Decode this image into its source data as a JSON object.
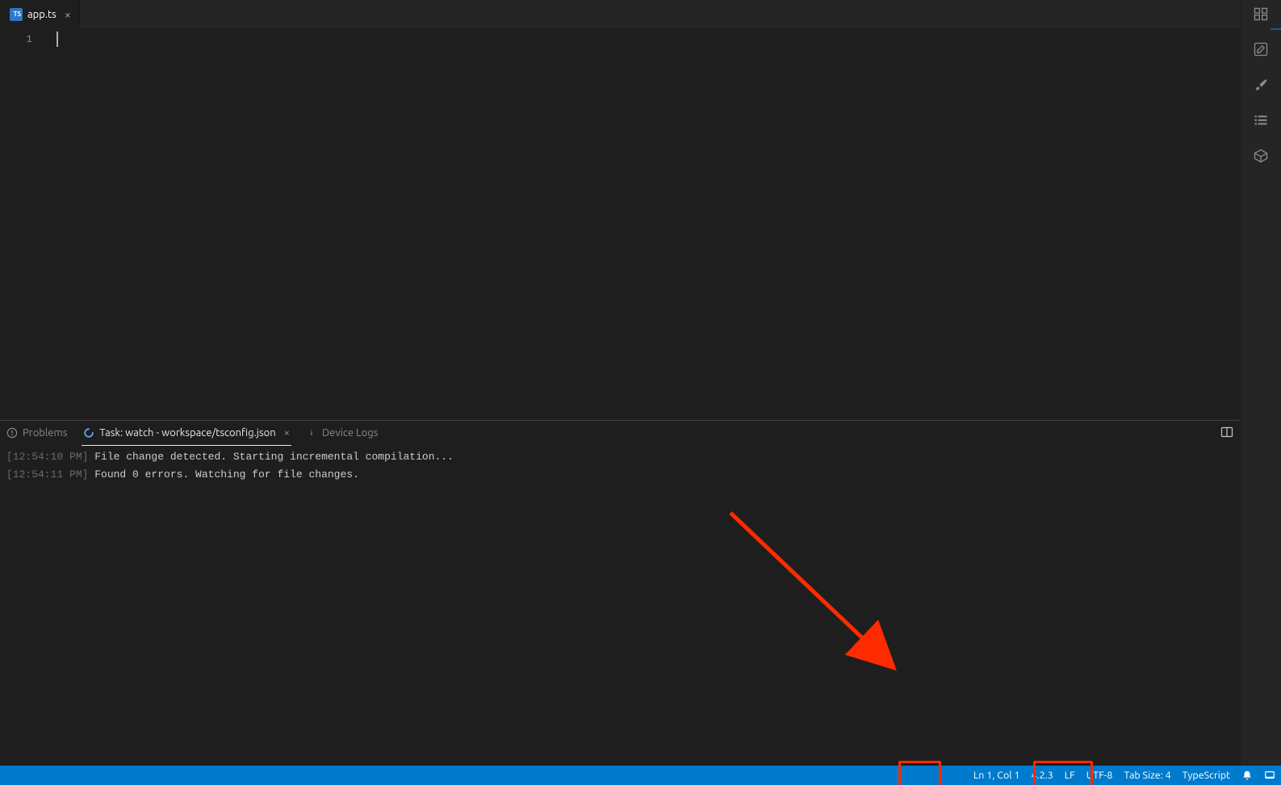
{
  "editor_tab": {
    "filename": "app.ts",
    "icon_label": "TS"
  },
  "gutter": {
    "line1": "1"
  },
  "panel": {
    "tabs": {
      "problems": "Problems",
      "task": "Task: watch - workspace/tsconfig.json",
      "device_logs": "Device Logs"
    },
    "log1_ts": "[12:54:10 PM]",
    "log1_msg": " File change detected. Starting incremental compilation...",
    "log2_ts": "[12:54:11 PM]",
    "log2_msg": " Found 0 errors. Watching for file changes."
  },
  "status": {
    "cursor": "Ln 1, Col 1",
    "ts_version": "4.2.3",
    "eol": "LF",
    "encoding": "UTF-8",
    "indent": "Tab Size: 4",
    "language": "TypeScript"
  }
}
